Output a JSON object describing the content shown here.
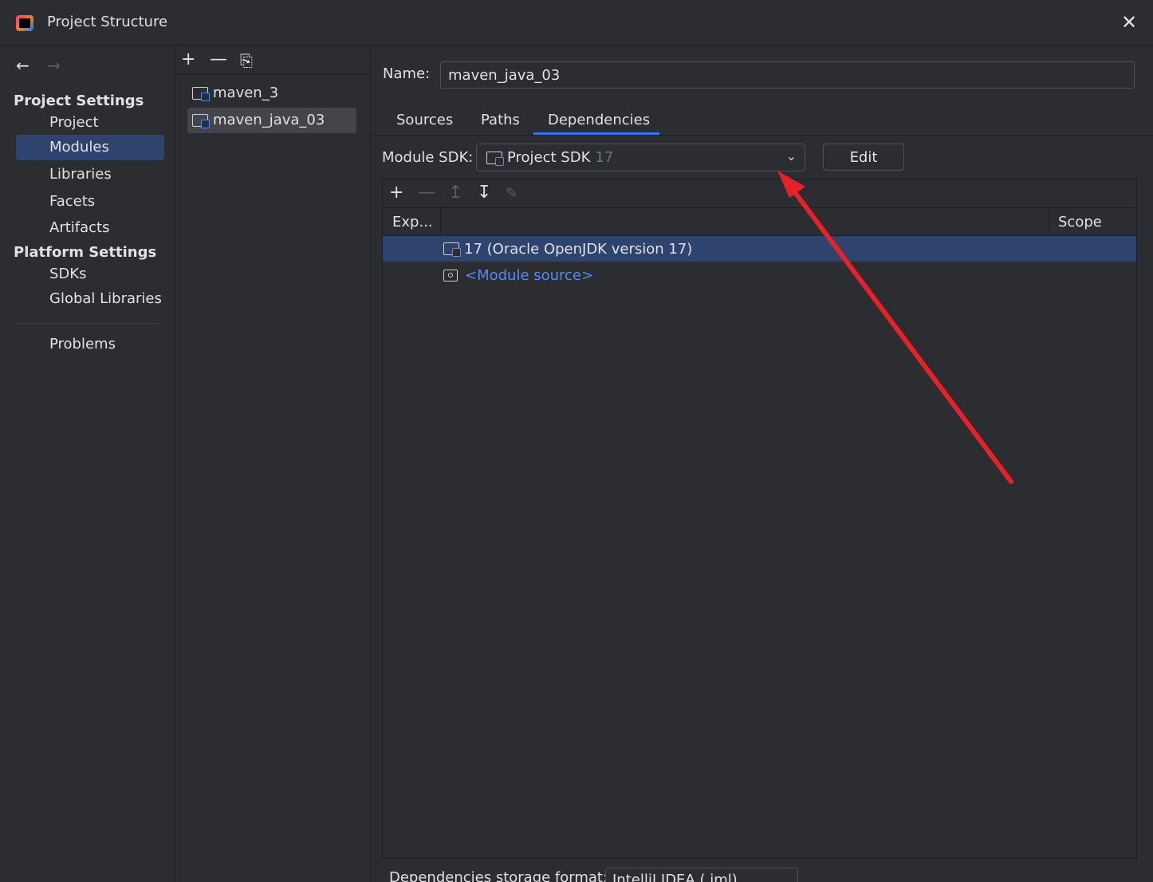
{
  "window": {
    "title": "Project Structure",
    "close_symbol": "✕"
  },
  "nav": {
    "back_symbol": "←",
    "forward_symbol": "→",
    "project_settings_title": "Project Settings",
    "platform_settings_title": "Platform Settings",
    "items": {
      "project": "Project",
      "modules": "Modules",
      "libraries": "Libraries",
      "facets": "Facets",
      "artifacts": "Artifacts",
      "sdks": "SDKs",
      "global_libraries": "Global Libraries",
      "problems": "Problems"
    },
    "selected": "Modules"
  },
  "modules": {
    "toolbar": {
      "add": "+",
      "remove": "—",
      "copy": "⎘"
    },
    "items": [
      "maven_3",
      "maven_java_03"
    ],
    "selected": "maven_java_03"
  },
  "main": {
    "name_label": "Name:",
    "name_value": "maven_java_03",
    "tabs": [
      "Sources",
      "Paths",
      "Dependencies"
    ],
    "active_tab": "Dependencies",
    "module_sdk_label": "Module SDK:",
    "module_sdk_value": "Project SDK",
    "module_sdk_version": "17",
    "edit_label": "Edit",
    "dep_toolbar": {
      "add": "+",
      "remove": "—",
      "up": "↥",
      "down": "↧",
      "edit": "✎"
    },
    "table": {
      "col_export": "Exp...",
      "col_scope": "Scope",
      "rows": [
        {
          "label": "17 (Oracle OpenJDK version 17)",
          "selected": true
        },
        {
          "label": "<Module source>",
          "selected": false
        }
      ]
    },
    "storage_label": "Dependencies storage format:",
    "storage_value": "IntelliJ IDEA (.iml)"
  },
  "colors": {
    "accent": "#3574f0",
    "selection": "#2e436e",
    "link": "#548af7",
    "annotation_arrow": "#e8202a"
  },
  "icons": {
    "logo": "intellij-logo-icon",
    "folder": "module-folder-icon",
    "sdk": "sdk-folder-icon",
    "module_source": "module-source-icon",
    "dropdown": "chevron-down-icon"
  }
}
